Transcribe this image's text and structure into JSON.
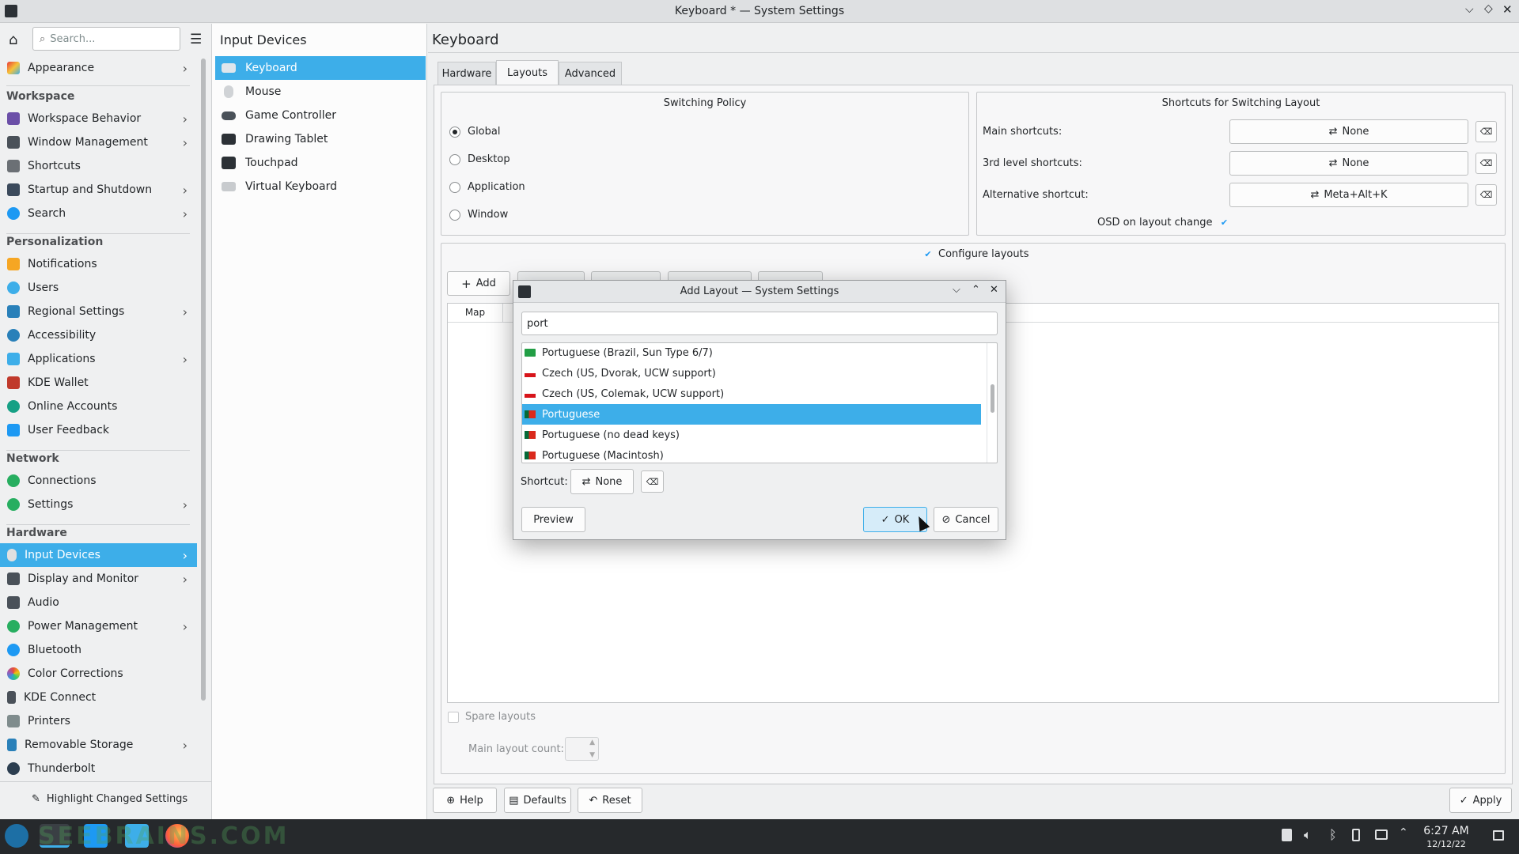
{
  "window": {
    "title": "Keyboard * — System Settings"
  },
  "sidebar": {
    "search_placeholder": "Search...",
    "appearance": "Appearance",
    "workspace_head": "Workspace",
    "workspace": [
      {
        "label": "Workspace Behavior"
      },
      {
        "label": "Window Management"
      },
      {
        "label": "Shortcuts"
      },
      {
        "label": "Startup and Shutdown"
      },
      {
        "label": "Search"
      }
    ],
    "personalization_head": "Personalization",
    "personalization": [
      {
        "label": "Notifications"
      },
      {
        "label": "Users"
      },
      {
        "label": "Regional Settings"
      },
      {
        "label": "Accessibility"
      },
      {
        "label": "Applications"
      },
      {
        "label": "KDE Wallet"
      },
      {
        "label": "Online Accounts"
      },
      {
        "label": "User Feedback"
      }
    ],
    "network_head": "Network",
    "network": [
      {
        "label": "Connections"
      },
      {
        "label": "Settings"
      }
    ],
    "hardware_head": "Hardware",
    "hardware": [
      {
        "label": "Input Devices"
      },
      {
        "label": "Display and Monitor"
      },
      {
        "label": "Audio"
      },
      {
        "label": "Power Management"
      },
      {
        "label": "Bluetooth"
      },
      {
        "label": "Color Corrections"
      },
      {
        "label": "KDE Connect"
      },
      {
        "label": "Printers"
      },
      {
        "label": "Removable Storage"
      },
      {
        "label": "Thunderbolt"
      }
    ],
    "highlight_button": "Highlight Changed Settings"
  },
  "middle": {
    "title": "Input Devices",
    "items": [
      {
        "label": "Keyboard"
      },
      {
        "label": "Mouse"
      },
      {
        "label": "Game Controller"
      },
      {
        "label": "Drawing Tablet"
      },
      {
        "label": "Touchpad"
      },
      {
        "label": "Virtual Keyboard"
      }
    ]
  },
  "main": {
    "title": "Keyboard",
    "tabs": [
      "Hardware",
      "Layouts",
      "Advanced"
    ],
    "switching": {
      "title": "Switching Policy",
      "options": [
        "Global",
        "Desktop",
        "Application",
        "Window"
      ],
      "selected": "Global"
    },
    "shortcuts": {
      "title": "Shortcuts for Switching Layout",
      "main_label": "Main shortcuts:",
      "main_value": "None",
      "third_label": "3rd level shortcuts:",
      "third_value": "None",
      "alt_label": "Alternative shortcut:",
      "alt_value": "Meta+Alt+K",
      "osd_label": "OSD on layout change"
    },
    "configure_label": "Configure layouts",
    "add_button": "Add",
    "map_header": "Map",
    "spare_label": "Spare layouts",
    "main_count_label": "Main layout count:",
    "footer": {
      "help": "Help",
      "defaults": "Defaults",
      "reset": "Reset",
      "apply": "Apply"
    }
  },
  "dialog": {
    "title": "Add Layout — System Settings",
    "filter_value": "port",
    "layouts": [
      {
        "label": "Portuguese (Brazil, Sun Type 6/7)",
        "flag": "br"
      },
      {
        "label": "Czech (US, Dvorak, UCW support)",
        "flag": "cz"
      },
      {
        "label": "Czech (US, Colemak, UCW support)",
        "flag": "cz"
      },
      {
        "label": "Portuguese",
        "flag": "pt"
      },
      {
        "label": "Portuguese (no dead keys)",
        "flag": "pt"
      },
      {
        "label": "Portuguese (Macintosh)",
        "flag": "pt"
      }
    ],
    "selected": "Portuguese",
    "shortcut_label": "Shortcut:",
    "shortcut_value": "None",
    "preview": "Preview",
    "ok": "OK",
    "cancel": "Cancel"
  },
  "taskbar": {
    "time": "6:27 AM",
    "date": "12/12/22",
    "watermark": "SEEBRAINS.COM"
  },
  "colors": {
    "accent": "#3daee9",
    "bg": "#eff0f1",
    "panel": "#f7f7f8",
    "taskbar": "#26292c"
  }
}
